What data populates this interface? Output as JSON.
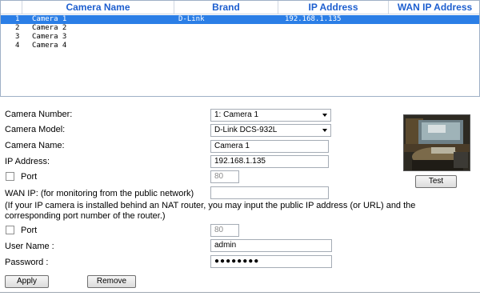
{
  "camera_list": {
    "columns": [
      "Camera Name",
      "Brand",
      "IP Address",
      "WAN IP Address"
    ],
    "rows": [
      {
        "num": "1",
        "name": "Camera 1",
        "brand": "D-Link",
        "ip": "192.168.1.135",
        "wan": "",
        "selected": true
      },
      {
        "num": "2",
        "name": "Camera 2",
        "brand": "",
        "ip": "",
        "wan": "",
        "selected": false
      },
      {
        "num": "3",
        "name": "Camera 3",
        "brand": "",
        "ip": "",
        "wan": "",
        "selected": false
      },
      {
        "num": "4",
        "name": "Camera 4",
        "brand": "",
        "ip": "",
        "wan": "",
        "selected": false
      }
    ],
    "selected_color": "#2b7ee6",
    "header_color": "#1e5fcf"
  },
  "form": {
    "camera_number_label": "Camera Number:",
    "camera_number_value": "1: Camera 1",
    "camera_model_label": "Camera Model:",
    "camera_model_value": "D-Link DCS-932L",
    "camera_name_label": "Camera Name:",
    "camera_name_value": "Camera 1",
    "ip_label": "IP Address:",
    "ip_value": "192.168.1.135",
    "port_label": "Port",
    "port_value": "80",
    "wan_label": "WAN IP: (for monitoring from the public network)",
    "wan_value": "",
    "wan_note": "(If your IP camera is installed behind an NAT router, you may input the public IP address (or URL) and the corresponding port number of the router.)",
    "wan_port_label": "Port",
    "wan_port_value": "80",
    "username_label": "User Name :",
    "username_value": "admin",
    "password_label": "Password :",
    "password_value": "●●●●●●●●"
  },
  "buttons": {
    "test": "Test",
    "apply": "Apply",
    "remove": "Remove"
  }
}
